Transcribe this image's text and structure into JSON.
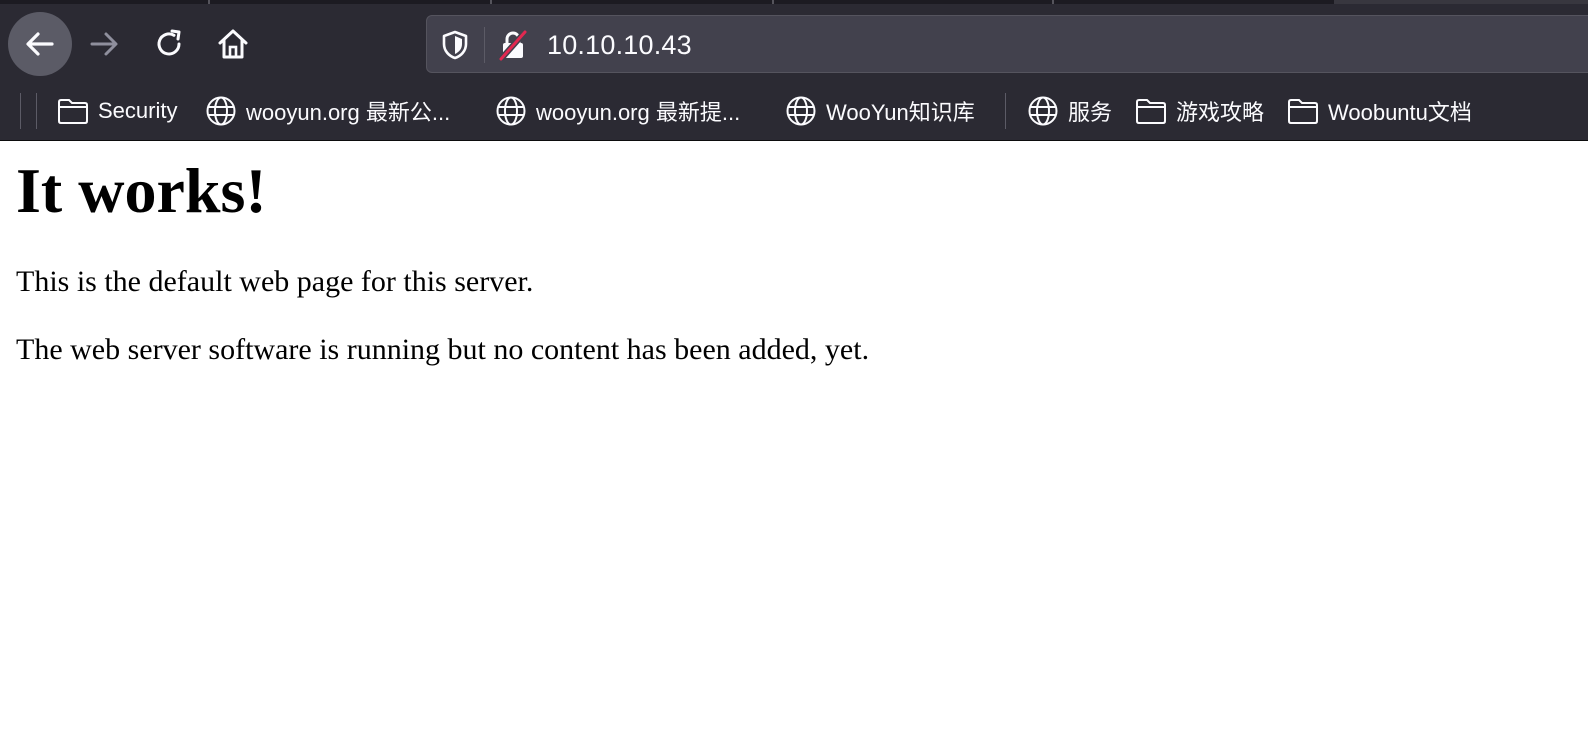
{
  "browser": {
    "url": "10.10.10.43",
    "nav_icons": {
      "back": "arrow-left-icon",
      "forward": "arrow-right-icon",
      "reload": "reload-icon",
      "home": "home-icon"
    },
    "urlbar_icons": {
      "tracking": "shield-icon",
      "security": "insecure-lock-icon"
    }
  },
  "bookmarks": [
    {
      "label": "Security",
      "icon": "folder-icon"
    },
    {
      "label": "wooyun.org 最新公...",
      "icon": "globe-icon"
    },
    {
      "label": "wooyun.org 最新提...",
      "icon": "globe-icon"
    },
    {
      "label": "WooYun知识库",
      "icon": "globe-icon"
    },
    {
      "label": "服务",
      "icon": "globe-icon"
    },
    {
      "label": "游戏攻略",
      "icon": "folder-icon"
    },
    {
      "label": "Woobuntu文档",
      "icon": "folder-icon"
    }
  ],
  "page": {
    "heading": "It works!",
    "paragraphs": [
      "This is the default web page for this server.",
      "The web server software is running but no content has been added, yet."
    ]
  },
  "colors": {
    "chrome_bg": "#2b2a33",
    "urlbar_bg": "#42414d",
    "chrome_text": "#fbfbfe",
    "insecure_slash": "#e22850",
    "page_bg": "#ffffff",
    "page_text": "#000000"
  }
}
